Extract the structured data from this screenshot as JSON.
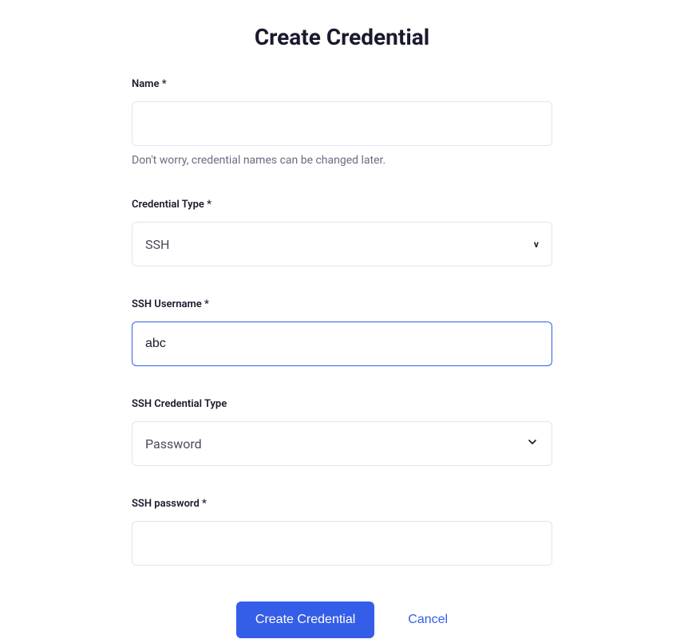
{
  "title": "Create Credential",
  "fields": {
    "name": {
      "label": "Name *",
      "value": "",
      "help": "Don't worry, credential names can be changed later."
    },
    "credential_type": {
      "label": "Credential Type *",
      "value": "SSH"
    },
    "ssh_username": {
      "label": "SSH Username *",
      "value": "abc"
    },
    "ssh_credential_type": {
      "label": "SSH Credential Type",
      "value": "Password"
    },
    "ssh_password": {
      "label": "SSH password *",
      "value": ""
    }
  },
  "buttons": {
    "submit": "Create Credential",
    "cancel": "Cancel"
  }
}
